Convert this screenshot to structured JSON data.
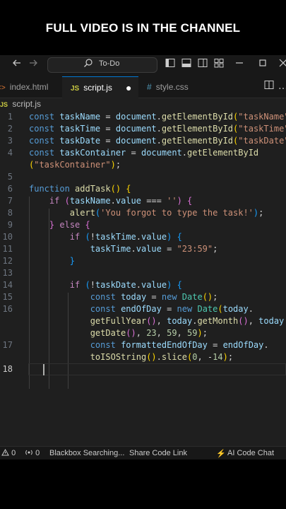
{
  "banner": {
    "text": "FULL VIDEO IS IN THE CHANNEL"
  },
  "titlebar": {
    "search_label": "To-Do",
    "icons": [
      "arrow-left-icon",
      "arrow-right-icon",
      "layout-sidebar-left-icon",
      "layout-panel-icon",
      "layout-sidebar-right-icon",
      "customize-layout-icon",
      "minimize-icon",
      "maximize-icon",
      "close-icon"
    ]
  },
  "tabs": [
    {
      "label": "index.html",
      "icon": "<>",
      "active": false
    },
    {
      "label": "script.js",
      "icon": "JS",
      "active": true
    },
    {
      "label": "style.css",
      "icon": "#",
      "active": false
    }
  ],
  "breadcrumb": {
    "icon": "JS",
    "file": "script.js"
  },
  "editor": {
    "current_line": "18",
    "line_numbers": [
      "1",
      "2",
      "3",
      "4",
      "",
      "5",
      "6",
      "7",
      "8",
      "9",
      "10",
      "11",
      "12",
      "13",
      "14",
      "15",
      "16",
      "",
      "",
      "17",
      "",
      "18"
    ]
  },
  "statusbar": {
    "warnings": "0",
    "ports": "0",
    "blackbox": "Blackbox Searching...",
    "share": "Share Code Link",
    "ai_chat": "AI Code Chat"
  },
  "colors": {
    "keyword": "#569cd6",
    "control": "#c586c0",
    "variable": "#9cdcfe",
    "function": "#dcdcaa",
    "string": "#ce9178",
    "number": "#b5cea8",
    "class": "#4ec9b0",
    "accent": "#0078d4"
  }
}
